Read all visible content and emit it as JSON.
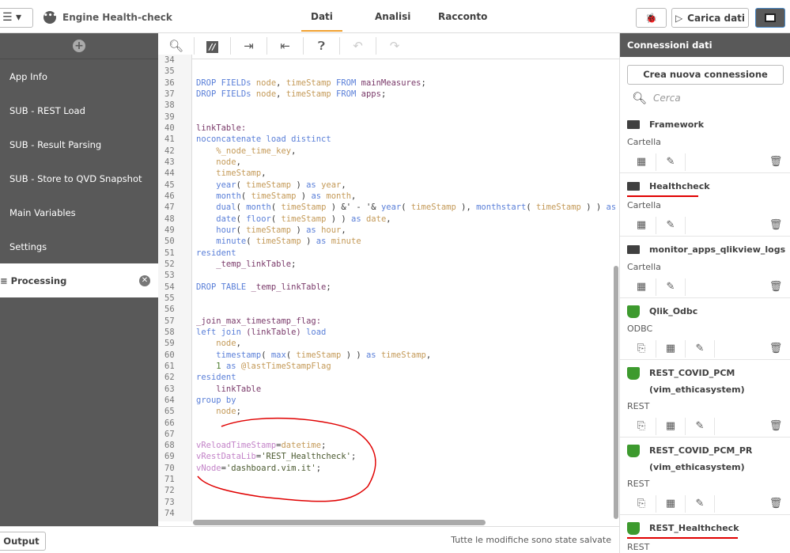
{
  "header": {
    "app_title": "Engine Health-check",
    "tabs": [
      {
        "label": "Dati",
        "active": true
      },
      {
        "label": "Analisi"
      },
      {
        "label": "Racconto"
      }
    ],
    "load_button": "Carica dati",
    "accent": "#f0a030"
  },
  "sidebar": {
    "items": [
      {
        "label": "App Info"
      },
      {
        "label": "SUB - REST Load"
      },
      {
        "label": "SUB - Result Parsing"
      },
      {
        "label": "SUB - Store to QVD Snapshot"
      },
      {
        "label": "Main Variables"
      },
      {
        "label": "Settings"
      },
      {
        "label": "Processing",
        "selected": true
      }
    ],
    "selected_icon": "≡"
  },
  "editor": {
    "line_start": 34,
    "lines": [
      [],
      [],
      [
        [
          "DROP FIELDs ",
          "k"
        ],
        [
          "node",
          "f"
        ],
        [
          ", ",
          "p"
        ],
        [
          "timeStamp ",
          "f"
        ],
        [
          "FROM ",
          "k"
        ],
        [
          "mainMeasures",
          "t"
        ],
        [
          ";",
          "p"
        ]
      ],
      [
        [
          "DROP FIELDs ",
          "k"
        ],
        [
          "node",
          "f"
        ],
        [
          ", ",
          "p"
        ],
        [
          "timeStamp ",
          "f"
        ],
        [
          "FROM ",
          "k"
        ],
        [
          "apps",
          "t"
        ],
        [
          ";",
          "p"
        ]
      ],
      [],
      [],
      [
        [
          "linkTable:",
          "t"
        ]
      ],
      [
        [
          "noconcatenate load distinct",
          "k"
        ]
      ],
      [
        [
          "    %_node_time_key",
          "f"
        ],
        [
          ",",
          "p"
        ]
      ],
      [
        [
          "    node",
          "f"
        ],
        [
          ",",
          "p"
        ]
      ],
      [
        [
          "    timeStamp",
          "f"
        ],
        [
          ",",
          "p"
        ]
      ],
      [
        [
          "    year",
          "k"
        ],
        [
          "( ",
          "p"
        ],
        [
          "timeStamp",
          "f"
        ],
        [
          " ) ",
          "p"
        ],
        [
          "as ",
          "k"
        ],
        [
          "year",
          "f"
        ],
        [
          ",",
          "p"
        ]
      ],
      [
        [
          "    month",
          "k"
        ],
        [
          "( ",
          "p"
        ],
        [
          "timeStamp",
          "f"
        ],
        [
          " ) ",
          "p"
        ],
        [
          "as ",
          "k"
        ],
        [
          "month",
          "f"
        ],
        [
          ",",
          "p"
        ]
      ],
      [
        [
          "    dual",
          "k"
        ],
        [
          "( ",
          "p"
        ],
        [
          "month",
          "k"
        ],
        [
          "( ",
          "p"
        ],
        [
          "timeStamp",
          "f"
        ],
        [
          " ) &' - '& ",
          "p"
        ],
        [
          "year",
          "k"
        ],
        [
          "( ",
          "p"
        ],
        [
          "timeStamp",
          "f"
        ],
        [
          " ), ",
          "p"
        ],
        [
          "monthstart",
          "k"
        ],
        [
          "( ",
          "p"
        ],
        [
          "timeStamp",
          "f"
        ],
        [
          " ) ) ",
          "p"
        ],
        [
          "as m",
          "k"
        ]
      ],
      [
        [
          "    date",
          "k"
        ],
        [
          "( ",
          "p"
        ],
        [
          "floor",
          "k"
        ],
        [
          "( ",
          "p"
        ],
        [
          "timeStamp",
          "f"
        ],
        [
          " ) ) ",
          "p"
        ],
        [
          "as ",
          "k"
        ],
        [
          "date",
          "f"
        ],
        [
          ",",
          "p"
        ]
      ],
      [
        [
          "    hour",
          "k"
        ],
        [
          "( ",
          "p"
        ],
        [
          "timeStamp",
          "f"
        ],
        [
          " ) ",
          "p"
        ],
        [
          "as ",
          "k"
        ],
        [
          "hour",
          "f"
        ],
        [
          ",",
          "p"
        ]
      ],
      [
        [
          "    minute",
          "k"
        ],
        [
          "( ",
          "p"
        ],
        [
          "timeStamp",
          "f"
        ],
        [
          " ) ",
          "p"
        ],
        [
          "as ",
          "k"
        ],
        [
          "minute",
          "f"
        ]
      ],
      [
        [
          "resident",
          "k"
        ]
      ],
      [
        [
          "    _temp_linkTable",
          "t"
        ],
        [
          ";",
          "p"
        ]
      ],
      [],
      [
        [
          "DROP TABLE ",
          "k"
        ],
        [
          "_temp_linkTable",
          "t"
        ],
        [
          ";",
          "p"
        ]
      ],
      [],
      [],
      [
        [
          "_join_max_timestamp_flag:",
          "t"
        ]
      ],
      [
        [
          "left join ",
          "k"
        ],
        [
          "(linkTable) ",
          "t"
        ],
        [
          "load",
          "k"
        ]
      ],
      [
        [
          "    node",
          "f"
        ],
        [
          ",",
          "p"
        ]
      ],
      [
        [
          "    timestamp",
          "k"
        ],
        [
          "( ",
          "p"
        ],
        [
          "max",
          "k"
        ],
        [
          "( ",
          "p"
        ],
        [
          "timeStamp",
          "f"
        ],
        [
          " ) ) ",
          "p"
        ],
        [
          "as ",
          "k"
        ],
        [
          "timeStamp",
          "f"
        ],
        [
          ",",
          "p"
        ]
      ],
      [
        [
          "    1 ",
          "n"
        ],
        [
          "as ",
          "k"
        ],
        [
          "@lastTimeStampFlag",
          "f"
        ]
      ],
      [
        [
          "resident",
          "k"
        ]
      ],
      [
        [
          "    linkTable",
          "t"
        ]
      ],
      [
        [
          "group by",
          "k"
        ]
      ],
      [
        [
          "    node",
          "f"
        ],
        [
          ";",
          "p"
        ]
      ],
      [],
      [],
      [
        [
          "vReloadTimeStamp",
          "v"
        ],
        [
          "=",
          "p"
        ],
        [
          "datetime",
          "f"
        ],
        [
          ";",
          "p"
        ]
      ],
      [
        [
          "vRestDataLib",
          "v"
        ],
        [
          "=",
          "p"
        ],
        [
          "'REST_Healthcheck'",
          "s"
        ],
        [
          ";",
          "p"
        ]
      ],
      [
        [
          "vNode",
          "v"
        ],
        [
          "=",
          "p"
        ],
        [
          "'dashboard.vim.it'",
          "s"
        ],
        [
          ";",
          "p"
        ]
      ],
      [],
      [],
      [],
      []
    ]
  },
  "footer": {
    "output_button": "Output",
    "status": "Tutte le modifiche sono state salvate"
  },
  "connections": {
    "title": "Connessioni dati",
    "new_button": "Crea nuova connessione",
    "search_placeholder": "Cerca",
    "items": [
      {
        "name": "Framework",
        "type": "Cartella",
        "icon": "folder",
        "actions": [
          "table",
          "edit"
        ]
      },
      {
        "name": "Healthcheck",
        "type": "Cartella",
        "icon": "folder",
        "actions": [
          "table",
          "edit"
        ],
        "underlined": true
      },
      {
        "name": "monitor_apps_qlikview_logs",
        "type": "Cartella",
        "icon": "folder",
        "actions": [
          "table",
          "edit"
        ]
      },
      {
        "name": "Qlik_Odbc",
        "type": "ODBC",
        "icon": "plug",
        "actions": [
          "insert",
          "table",
          "edit"
        ]
      },
      {
        "name": "REST_COVID_PCM (vim_ethicasystem)",
        "type": "REST",
        "icon": "plug",
        "actions": [
          "insert",
          "table",
          "edit"
        ]
      },
      {
        "name": "REST_COVID_PCM_PR (vim_ethicasystem)",
        "type": "REST",
        "icon": "plug",
        "actions": [
          "insert",
          "table",
          "edit"
        ]
      },
      {
        "name": "REST_Healthcheck",
        "type": "REST",
        "icon": "plug",
        "actions": [],
        "underlined": true
      }
    ],
    "plug_color": "#3d9a2e"
  },
  "annotation_color": "#e00000"
}
